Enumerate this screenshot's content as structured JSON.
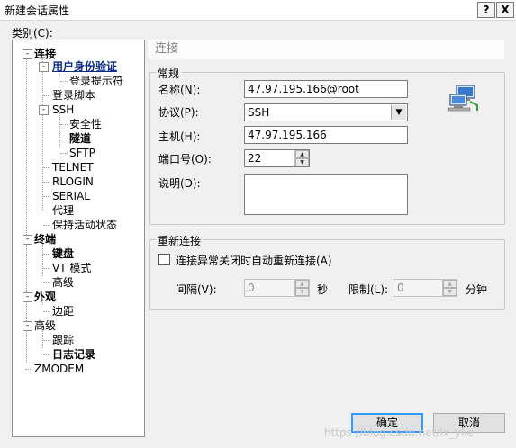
{
  "window": {
    "title": "新建会话属性",
    "help_btn": "?",
    "close_btn": "X"
  },
  "category_label": "类别(C):",
  "tree": [
    {
      "label": "连接",
      "bold": true,
      "expander": "-"
    },
    {
      "label": "用户身份验证",
      "bold": true,
      "selected": true,
      "expander": "-"
    },
    {
      "label": "登录提示符"
    },
    {
      "label": "登录脚本"
    },
    {
      "label": "SSH",
      "expander": "-"
    },
    {
      "label": "安全性"
    },
    {
      "label": "隧道",
      "bold": true
    },
    {
      "label": "SFTP"
    },
    {
      "label": "TELNET"
    },
    {
      "label": "RLOGIN"
    },
    {
      "label": "SERIAL"
    },
    {
      "label": "代理"
    },
    {
      "label": "保持活动状态"
    },
    {
      "label": "终端",
      "bold": true,
      "expander": "-"
    },
    {
      "label": "键盘",
      "bold": true
    },
    {
      "label": "VT 模式"
    },
    {
      "label": "高级"
    },
    {
      "label": "外观",
      "bold": true,
      "expander": "-"
    },
    {
      "label": "边距"
    },
    {
      "label": "高级",
      "expander": "-"
    },
    {
      "label": "跟踪"
    },
    {
      "label": "日志记录",
      "bold": true
    },
    {
      "label": "ZMODEM"
    }
  ],
  "panel_header": "连接",
  "general": {
    "legend": "常规",
    "name_label": "名称(N):",
    "name_value": "47.97.195.166@root",
    "protocol_label": "协议(P):",
    "protocol_value": "SSH",
    "host_label": "主机(H):",
    "host_value": "47.97.195.166",
    "port_label": "端口号(O):",
    "port_value": "22",
    "desc_label": "说明(D):",
    "desc_value": ""
  },
  "reconnect": {
    "legend": "重新连接",
    "checkbox_label": "连接异常关闭时自动重新连接(A)",
    "checked": false,
    "interval_label": "间隔(V):",
    "interval_value": "0",
    "interval_unit": "秒",
    "limit_label": "限制(L):",
    "limit_value": "0",
    "limit_unit": "分钟"
  },
  "buttons": {
    "ok": "确定",
    "cancel": "取消"
  },
  "watermark": "https://blog.csdn.net/lx_ylie"
}
